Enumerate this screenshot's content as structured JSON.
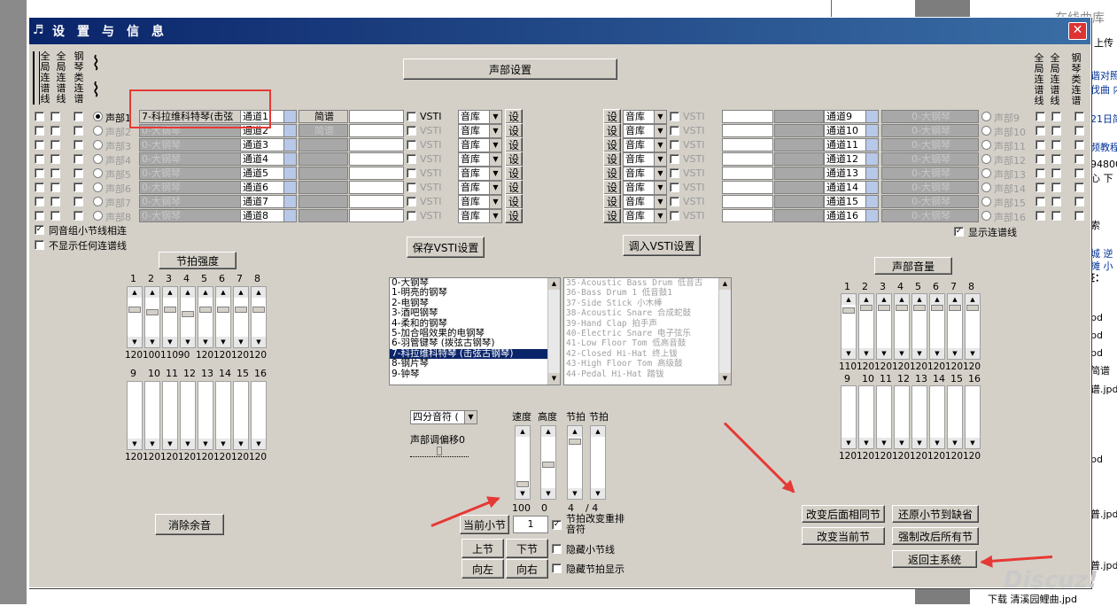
{
  "window": {
    "title": "设置与信息",
    "close": "✕",
    "icon": "music-notes-icon"
  },
  "background": {
    "right_texts": [
      "在线曲库",
      "上传",
      "谐对照",
      "伐曲 内",
      "21日简",
      "频教程",
      "94800",
      "心 下",
      "索",
      "城 逆",
      "摊 小",
      "签：",
      "pd",
      "pd",
      "pd",
      "简谱",
      "谱.jpd",
      "pd",
      "普.jpd",
      "普.jpd",
      "下载 清溪园鲤曲.jpd"
    ]
  },
  "left_headers": [
    "全局连谱线",
    "全局连谱线",
    "钢琴类连谱"
  ],
  "right_headers": [
    "全局连谱线",
    "全局连谱线",
    "钢琴类连谱"
  ],
  "voice_settings_button": "声部设置",
  "left_voices": [
    {
      "label": "声部1",
      "name": "7-科拉维科特琴(击弦",
      "channel": "通道1",
      "notation": "简谱",
      "vsti": "VSTI",
      "lib": "音库",
      "set": "设",
      "active": true
    },
    {
      "label": "声部2",
      "name": "0-大钢琴",
      "channel": "通道2",
      "notation": "简谱",
      "vsti": "VSTI",
      "lib": "音库",
      "set": "设",
      "active": false
    },
    {
      "label": "声部3",
      "name": "0-大钢琴",
      "channel": "通道3",
      "notation": "",
      "vsti": "VSTI",
      "lib": "音库",
      "set": "设",
      "active": false
    },
    {
      "label": "声部4",
      "name": "0-大钢琴",
      "channel": "通道4",
      "notation": "",
      "vsti": "VSTI",
      "lib": "音库",
      "set": "设",
      "active": false
    },
    {
      "label": "声部5",
      "name": "0-大钢琴",
      "channel": "通道5",
      "notation": "",
      "vsti": "VSTI",
      "lib": "音库",
      "set": "设",
      "active": false
    },
    {
      "label": "声部6",
      "name": "0-大钢琴",
      "channel": "通道6",
      "notation": "",
      "vsti": "VSTI",
      "lib": "音库",
      "set": "设",
      "active": false
    },
    {
      "label": "声部7",
      "name": "0-大钢琴",
      "channel": "通道7",
      "notation": "",
      "vsti": "VSTI",
      "lib": "音库",
      "set": "设",
      "active": false
    },
    {
      "label": "声部8",
      "name": "0-大钢琴",
      "channel": "通道8",
      "notation": "",
      "vsti": "VSTI",
      "lib": "音库",
      "set": "设",
      "active": false
    }
  ],
  "right_voices": [
    {
      "label": "声部9",
      "name": "0-大钢琴",
      "channel": "通道9",
      "vsti": "VSTI",
      "lib": "音库",
      "set": "设"
    },
    {
      "label": "声部10",
      "name": "0-大钢琴",
      "channel": "通道10",
      "vsti": "VSTI",
      "lib": "音库",
      "set": "设"
    },
    {
      "label": "声部11",
      "name": "0-大钢琴",
      "channel": "通道11",
      "vsti": "VSTI",
      "lib": "音库",
      "set": "设"
    },
    {
      "label": "声部12",
      "name": "0-大钢琴",
      "channel": "通道12",
      "vsti": "VSTI",
      "lib": "音库",
      "set": "设"
    },
    {
      "label": "声部13",
      "name": "0-大钢琴",
      "channel": "通道13",
      "vsti": "VSTI",
      "lib": "音库",
      "set": "设"
    },
    {
      "label": "声部14",
      "name": "0-大钢琴",
      "channel": "通道14",
      "vsti": "VSTI",
      "lib": "音库",
      "set": "设"
    },
    {
      "label": "声部15",
      "name": "0-大钢琴",
      "channel": "通道15",
      "vsti": "VSTI",
      "lib": "音库",
      "set": "设"
    },
    {
      "label": "声部16",
      "name": "0-大钢琴",
      "channel": "通道16",
      "vsti": "VSTI",
      "lib": "音库",
      "set": "设"
    }
  ],
  "options": {
    "same_group_link": "同音组小节线相连",
    "hide_all_links": "不显示任何连谱线",
    "show_links": "显示连谱线"
  },
  "vsti_buttons": {
    "save": "保存VSTI设置",
    "load": "调入VSTI设置"
  },
  "beat_strength": {
    "title": "节拍强度",
    "top_nums": [
      "1",
      "2",
      "3",
      "4",
      "5",
      "6",
      "7",
      "8"
    ],
    "top_levels": [
      0.75,
      0.67,
      0.75,
      0.6,
      0.75,
      0.75,
      0.75,
      0.75
    ],
    "top_values": [
      "120",
      "100",
      "110",
      "90",
      "120",
      "120",
      "120",
      "120"
    ],
    "bottom_nums": [
      "9",
      "10",
      "11",
      "12",
      "13",
      "14",
      "15",
      "16"
    ],
    "bottom_values": [
      "120",
      "120",
      "120",
      "120",
      "120",
      "120",
      "120",
      "120"
    ]
  },
  "instruments": [
    "0-大钢琴",
    "1-明亮的钢琴",
    "2-电钢琴",
    "3-酒吧钢琴",
    "4-柔和的钢琴",
    "5-加合唱效果的电钢琴",
    "6-羽管键琴 (拨弦古钢琴)",
    "7-科拉维科特琴 (击弦古钢琴)",
    "8-钢片琴",
    "9-钟琴"
  ],
  "selected_instrument_index": 7,
  "drums": [
    "35-Acoustic Bass Drum  低音古",
    "36-Bass Drum 1 低音鼓1",
    "37-Side Stick 小木棒",
    "38-Acoustic Snare 合成蛇鼓",
    "39-Hand Clap 拍手声",
    "40-Electric Snare 电子弦乐",
    "41-Low Floor Tom 低高音鼓",
    "42-Closed Hi-Hat 终上钹",
    "43-High Floor Tom 高级鼓",
    "44-Pedal Hi-Hat 踏钹"
  ],
  "note_controls": {
    "note_combo": "四分音符 (",
    "offset_label": "声部调偏移0",
    "headers": [
      "速度",
      "高度",
      "节拍",
      "节拍"
    ],
    "values": [
      "100",
      "0",
      "4",
      "/ 4"
    ],
    "current_bar": "当前小节",
    "bar_value": "1",
    "beat_change": "节拍改变重排音符",
    "prev": "上节",
    "next": "下节",
    "left": "向左",
    "right": "向右",
    "hide_bar": "隐藏小节线",
    "hide_beat": "隐藏节拍显示"
  },
  "clear_button": "消除余音",
  "voice_volume": {
    "title": "声部音量",
    "top_nums": [
      "1",
      "2",
      "3",
      "4",
      "5",
      "6",
      "7",
      "8"
    ],
    "top_levels": [
      0.92,
      1,
      1,
      1,
      1,
      1,
      1,
      1
    ],
    "top_values": [
      "110",
      "120",
      "120",
      "120",
      "120",
      "120",
      "120",
      "120"
    ],
    "bottom_nums": [
      "9",
      "10",
      "11",
      "12",
      "13",
      "14",
      "15",
      "16"
    ],
    "bottom_values": [
      "120",
      "120",
      "120",
      "120",
      "120",
      "120",
      "120",
      "120"
    ]
  },
  "action_buttons": {
    "change_after": "改变后面相同节",
    "restore": "还原小节到缺省",
    "change_current": "改变当前节",
    "force_all": "强制改后所有节",
    "return": "返回主系统"
  },
  "watermark": "Discuz!"
}
